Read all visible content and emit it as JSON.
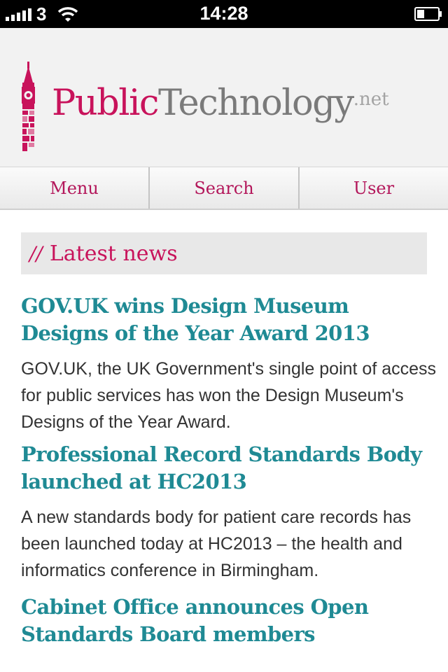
{
  "status_bar": {
    "carrier": "3",
    "time": "14:28",
    "signal_bars": 5,
    "icons": [
      "signal-icon",
      "wifi-icon",
      "battery-icon"
    ]
  },
  "header": {
    "logo": {
      "primary": "Public",
      "secondary": "Technology",
      "suffix": ".net",
      "tower_icon": "big-ben-icon"
    }
  },
  "nav": {
    "items": [
      {
        "label": "Menu"
      },
      {
        "label": "Search"
      },
      {
        "label": "User"
      }
    ]
  },
  "section": {
    "slashes": "//",
    "title": "Latest news"
  },
  "articles": [
    {
      "title": "GOV.UK wins Design Museum Designs of the Year Award 2013",
      "summary": "GOV.UK, the UK Government's single point of access for public services has won the Design Museum's Designs of the Year Award."
    },
    {
      "title": "Professional Record Standards Body launched at HC2013",
      "summary": "A new standards body for patient care records has been launched today at HC2013 – the health and informatics conference in Birmingham."
    },
    {
      "title": "Cabinet Office announces Open Standards Board members",
      "summary": ""
    }
  ],
  "colors": {
    "brand": "#c8135b",
    "link": "#1f8a94",
    "text": "#333333",
    "logo_grey": "#7a7a7a"
  }
}
